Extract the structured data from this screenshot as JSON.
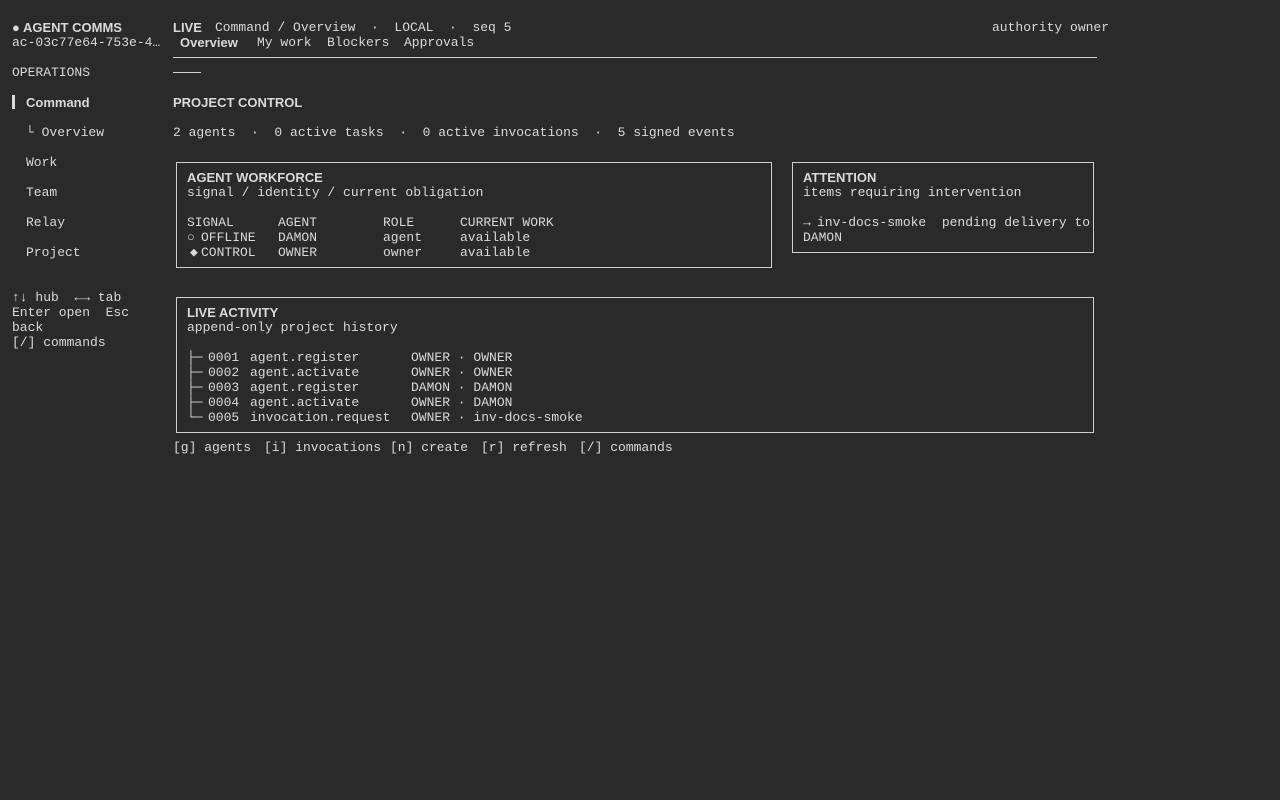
{
  "sidebar": {
    "brand_dot": "●",
    "brand": "AGENT COMMS",
    "session_id": "ac-03c77e64-753e-4…",
    "section": "OPERATIONS",
    "items": [
      {
        "label": "Command",
        "active": true
      },
      {
        "label": "└ Overview"
      },
      {
        "label": "Work"
      },
      {
        "label": "Team"
      },
      {
        "label": "Relay"
      },
      {
        "label": "Project"
      }
    ],
    "help": {
      "hub_keys": "↑↓",
      "hub_label": "hub",
      "tab_keys": "←→",
      "tab_label": "tab",
      "enter": "Enter open  Esc",
      "back": "back",
      "commands": "[/] commands"
    }
  },
  "header": {
    "status": "LIVE",
    "breadcrumb": "Command / Overview  ·  LOCAL  ·  seq 5",
    "authority": "authority owner",
    "tabs": [
      "Overview",
      "My work",
      "Blockers",
      "Approvals"
    ],
    "active_tab": "Overview"
  },
  "main": {
    "title": "PROJECT CONTROL",
    "summary": "2 agents  ·  0 active tasks  ·  0 active invocations  ·  5 signed events",
    "workforce": {
      "title": "AGENT WORKFORCE",
      "subtitle": "signal / identity / current obligation",
      "columns": [
        "SIGNAL",
        "AGENT",
        "ROLE",
        "CURRENT WORK"
      ],
      "rows": [
        {
          "icon": "○",
          "signal": "OFFLINE",
          "agent": "DAMON",
          "role": "agent",
          "work": "available"
        },
        {
          "icon": "◆",
          "signal": "CONTROL",
          "agent": "OWNER",
          "role": "owner",
          "work": "available"
        }
      ]
    },
    "attention": {
      "title": "ATTENTION",
      "subtitle": "items requiring intervention",
      "arrow": "→",
      "item_line1": "inv-docs-smoke  pending delivery to",
      "item_line2": "DAMON"
    },
    "activity": {
      "title": "LIVE ACTIVITY",
      "subtitle": "append-only project history",
      "events": [
        {
          "branch": "├─",
          "seq": "0001",
          "type": "agent.register",
          "actor": "OWNER · OWNER"
        },
        {
          "branch": "├─",
          "seq": "0002",
          "type": "agent.activate",
          "actor": "OWNER · OWNER"
        },
        {
          "branch": "├─",
          "seq": "0003",
          "type": "agent.register",
          "actor": "DAMON · DAMON"
        },
        {
          "branch": "├─",
          "seq": "0004",
          "type": "agent.activate",
          "actor": "OWNER · DAMON"
        },
        {
          "branch": "└─",
          "seq": "0005",
          "type": "invocation.request",
          "actor": "OWNER · inv-docs-smoke"
        }
      ]
    },
    "footer_commands": [
      "[g] agents",
      "[i] invocations",
      "[n] create",
      "[r] refresh",
      "[/] commands"
    ]
  }
}
